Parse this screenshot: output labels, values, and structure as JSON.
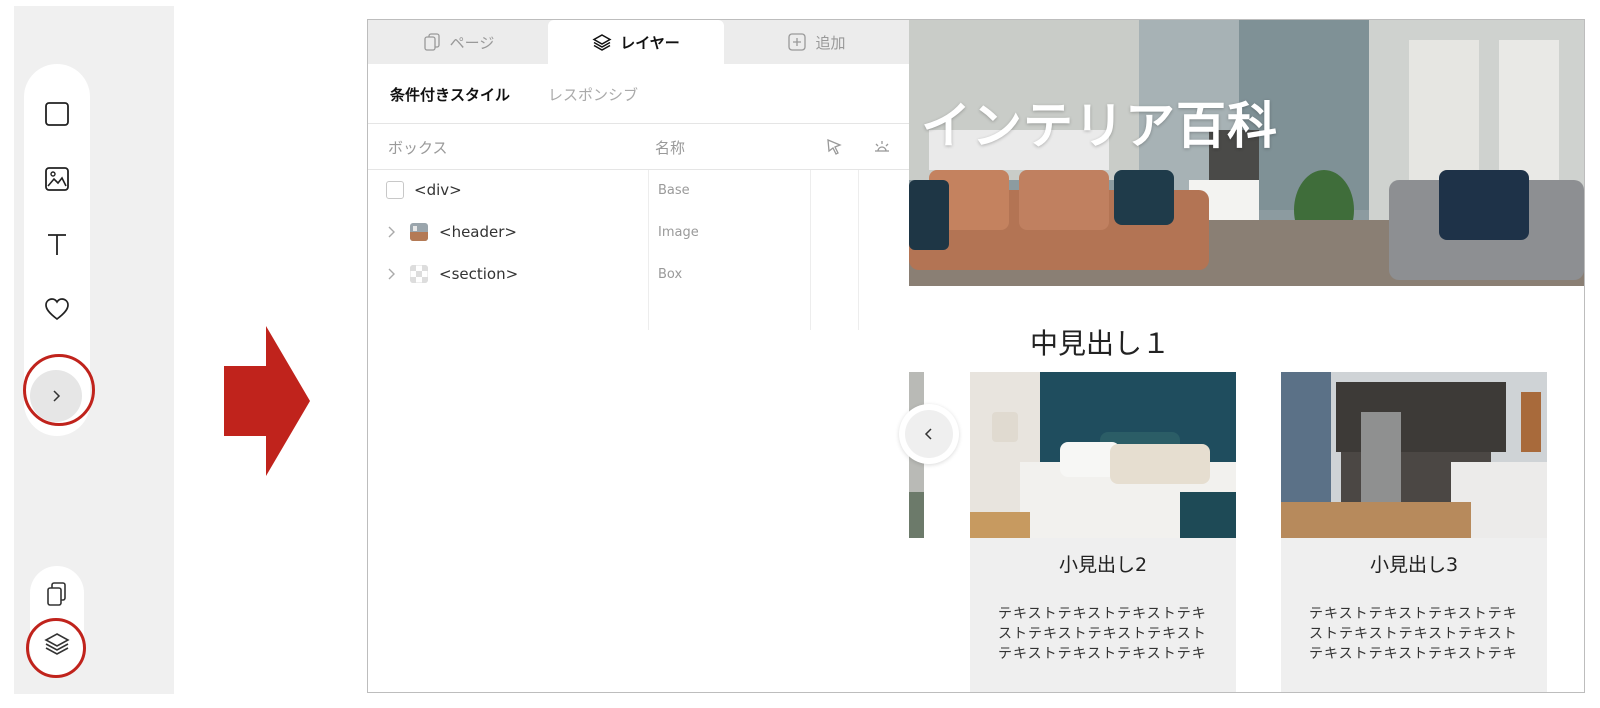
{
  "toolbar": {
    "tools": [
      "box-tool",
      "image-tool",
      "text-tool",
      "favorite-tool"
    ],
    "expand_icon": "chevron-right-icon",
    "bottom_tools": [
      "pages-icon",
      "layers-icon"
    ]
  },
  "annotation": {
    "arrow_color": "#c0231c",
    "highlight_color": "#c0231c"
  },
  "layers_panel": {
    "tabs": [
      {
        "label": "ページ",
        "icon": "pages-icon",
        "active": false
      },
      {
        "label": "レイヤー",
        "icon": "layers-icon",
        "active": true
      },
      {
        "label": "追加",
        "icon": "add-icon",
        "active": false
      }
    ],
    "subtabs": [
      {
        "label": "条件付きスタイル",
        "active": true
      },
      {
        "label": "レスポンシブ",
        "active": false
      }
    ],
    "columns": {
      "box": "ボックス",
      "name": "名称",
      "pointer_icon": "cursor-icon",
      "visibility_icon": "sun-icon"
    },
    "rows": [
      {
        "tag": "<div>",
        "type": "Base",
        "control": "checkbox"
      },
      {
        "tag": "<header>",
        "type": "Image",
        "control": "expand"
      },
      {
        "tag": "<section>",
        "type": "Box",
        "control": "expand"
      }
    ]
  },
  "preview": {
    "hero_title": "インテリア百科",
    "section_heading": "中見出し１",
    "collapse_icon": "chevron-left-icon",
    "cards": [
      {
        "title": "小見出し2",
        "text": "テキストテキストテキストテキストテキストテキストテキストテキストテキストテキストテキ"
      },
      {
        "title": "小見出し3",
        "text": "テキストテキストテキストテキストテキストテキストテキストテキストテキストテキストテキ"
      }
    ]
  }
}
